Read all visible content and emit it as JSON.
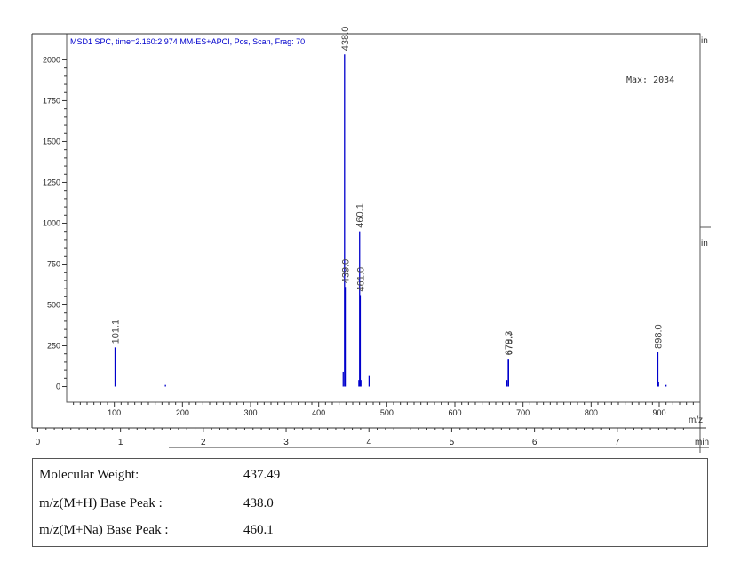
{
  "chart_data": {
    "type": "bar",
    "subtype": "mass-spectrum",
    "title": "MSD1 SPC, time=2.160:2.974   MM-ES+APCI, Pos, Scan, Frag: 70",
    "annotation": "Max: 2034",
    "xlabel": "m/z",
    "xlim": [
      30,
      960
    ],
    "x_ticks": [
      100,
      200,
      300,
      400,
      500,
      600,
      700,
      800,
      900
    ],
    "ylim": [
      -95,
      2160
    ],
    "y_ticks": [
      0,
      250,
      500,
      750,
      1000,
      1250,
      1500,
      1750,
      2000
    ],
    "time_axis": {
      "label": "min",
      "ticks": [
        0,
        1,
        2,
        3,
        4,
        5,
        6,
        7
      ],
      "range": [
        -0.08,
        8.0
      ]
    },
    "right_labels": [
      "in",
      "in"
    ],
    "series_color": "#0000cc",
    "label_color": "#444444",
    "peaks": [
      {
        "mz": 101.1,
        "intensity": 240,
        "label": "101.1"
      },
      {
        "mz": 175.0,
        "intensity": 10,
        "label": ""
      },
      {
        "mz": 436.0,
        "intensity": 90,
        "label": ""
      },
      {
        "mz": 438.0,
        "intensity": 2034,
        "label": "438.0"
      },
      {
        "mz": 439.0,
        "intensity": 610,
        "label": "439.0"
      },
      {
        "mz": 459.0,
        "intensity": 40,
        "label": ""
      },
      {
        "mz": 460.1,
        "intensity": 950,
        "label": "460.1"
      },
      {
        "mz": 461.0,
        "intensity": 560,
        "label": "461.0"
      },
      {
        "mz": 462.0,
        "intensity": 40,
        "label": ""
      },
      {
        "mz": 474.0,
        "intensity": 70,
        "label": ""
      },
      {
        "mz": 676.4,
        "intensity": 40,
        "label": ""
      },
      {
        "mz": 678.3,
        "intensity": 170,
        "label": "679.3"
      },
      {
        "mz": 678.7,
        "intensity": 170,
        "label": "678.7"
      },
      {
        "mz": 898.0,
        "intensity": 210,
        "label": "898.0"
      },
      {
        "mz": 899.0,
        "intensity": 30,
        "label": ""
      },
      {
        "mz": 910.0,
        "intensity": 10,
        "label": ""
      }
    ]
  },
  "info": [
    {
      "label": "Molecular Weight:",
      "value": "437.49"
    },
    {
      "label": "m/z(M+H) Base Peak :",
      "value": "438.0"
    },
    {
      "label": "m/z(M+Na) Base Peak :",
      "value": "460.1"
    }
  ]
}
